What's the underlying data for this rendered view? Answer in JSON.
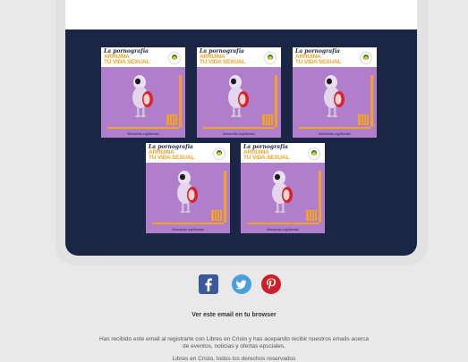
{
  "colors": {
    "page_background": "#e9e9e9",
    "panel_navy": "#1b2644",
    "card_purple": "#b07ecb",
    "accent_orange": "#f2a227",
    "facebook_blue": "#3b5998",
    "twitter_blue": "#4a9fe0",
    "pinterest_red": "#cb2027"
  },
  "cards": [
    {
      "script": "La pornografía",
      "headline_line1": "ARRUINA",
      "headline_line2": "TU VIDA SEXUAL",
      "url": "librescristo.org/libertad"
    },
    {
      "script": "La pornografía",
      "headline_line1": "ARRUINA",
      "headline_line2": "TU VIDA SEXUAL",
      "url": "librescristo.org/libertad"
    },
    {
      "script": "La pornografía",
      "headline_line1": "ARRUINA",
      "headline_line2": "TU VIDA SEXUAL",
      "url": "librescristo.org/libertad"
    },
    {
      "script": "La pornografía",
      "headline_line1": "ARRUINA",
      "headline_line2": "TU VIDA SEXUAL",
      "url": "librescristo.org/libertad"
    },
    {
      "script": "La pornografía",
      "headline_line1": "ARRUINA",
      "headline_line2": "TU VIDA SEXUAL",
      "url": "librescristo.org/libertad"
    }
  ],
  "social": {
    "facebook_icon": "facebook-icon",
    "twitter_icon": "twitter-icon",
    "pinterest_icon": "pinterest-icon"
  },
  "footer": {
    "browser_link": "Ver este email en tu browser",
    "disclaimer": "Has recibido este email al registrarte con Libres en Cristo y has acepando recibir nuestros emails acerca de eventos, noticias y ofertas epsciales.",
    "copyright": "Libres en Cristo, todos los derechos reservados"
  }
}
